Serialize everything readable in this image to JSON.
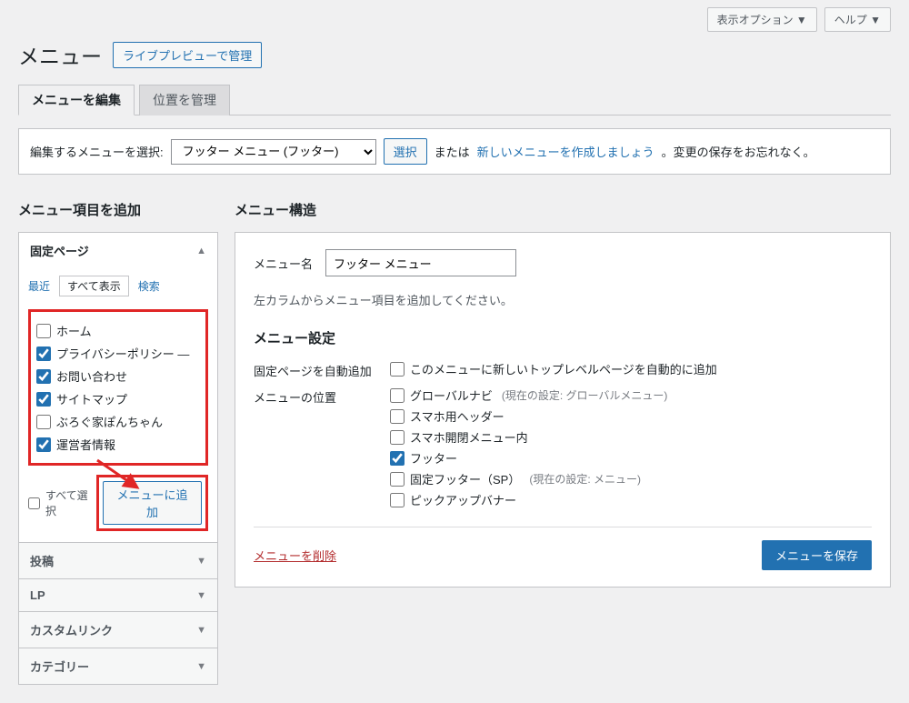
{
  "topActions": {
    "screenOptions": "表示オプション ▼",
    "help": "ヘルプ ▼"
  },
  "header": {
    "title": "メニュー",
    "livePreview": "ライブプレビューで管理"
  },
  "tabs": {
    "edit": "メニューを編集",
    "locations": "位置を管理"
  },
  "selectRow": {
    "label": "編集するメニューを選択:",
    "value": "フッター メニュー (フッター)",
    "button": "選択",
    "or": "または",
    "createLink": "新しいメニューを作成しましょう",
    "suffix": "。変更の保存をお忘れなく。"
  },
  "left": {
    "heading": "メニュー項目を追加",
    "panels": {
      "pages": {
        "title": "固定ページ",
        "innerTabs": {
          "recent": "最近",
          "all": "すべて表示",
          "search": "検索"
        },
        "items": [
          {
            "label": "ホーム",
            "checked": false
          },
          {
            "label": "プライバシーポリシー —",
            "checked": true
          },
          {
            "label": "お問い合わせ",
            "checked": true
          },
          {
            "label": "サイトマップ",
            "checked": true
          },
          {
            "label": "ぶろぐ家ぽんちゃん",
            "checked": false
          },
          {
            "label": "運営者情報",
            "checked": true
          }
        ],
        "selectAll": "すべて選択",
        "addBtn": "メニューに追加"
      },
      "posts": "投稿",
      "lp": "LP",
      "custom": "カスタムリンク",
      "category": "カテゴリー"
    }
  },
  "right": {
    "heading": "メニュー構造",
    "nameLabel": "メニュー名",
    "nameValue": "フッター メニュー",
    "hint": "左カラムからメニュー項目を追加してください。",
    "settingsHeading": "メニュー設定",
    "autoAdd": {
      "label": "固定ページを自動追加",
      "opt": "このメニューに新しいトップレベルページを自動的に追加"
    },
    "locations": {
      "label": "メニューの位置",
      "opts": [
        {
          "label": "グローバルナビ",
          "note": "(現在の設定: グローバルメニュー)",
          "checked": false
        },
        {
          "label": "スマホ用ヘッダー",
          "note": "",
          "checked": false
        },
        {
          "label": "スマホ開閉メニュー内",
          "note": "",
          "checked": false
        },
        {
          "label": "フッター",
          "note": "",
          "checked": true
        },
        {
          "label": "固定フッター（SP）",
          "note": "(現在の設定: メニュー)",
          "checked": false
        },
        {
          "label": "ピックアップバナー",
          "note": "",
          "checked": false
        }
      ]
    },
    "deleteLink": "メニューを削除",
    "saveBtn": "メニューを保存"
  }
}
